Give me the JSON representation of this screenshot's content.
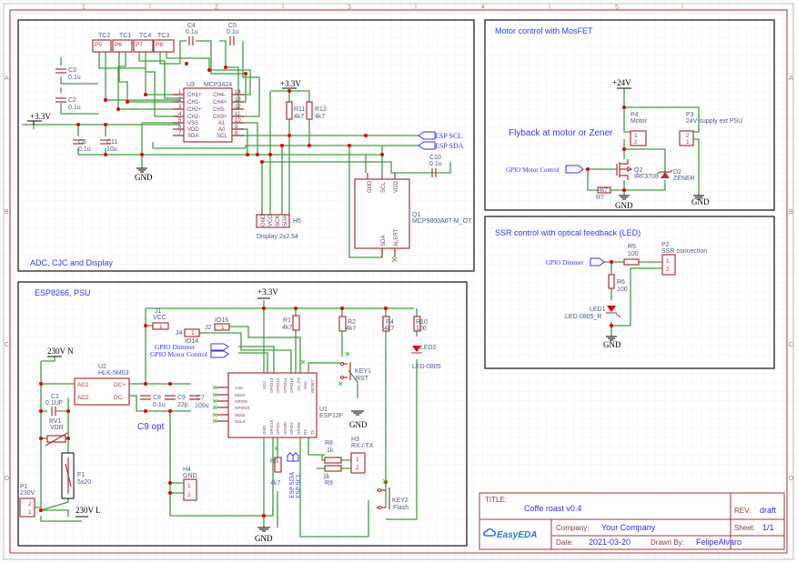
{
  "sheet": {
    "columns": [
      "1",
      "2",
      "3",
      "4",
      "5"
    ],
    "rows": [
      "A",
      "B",
      "C",
      "D"
    ]
  },
  "adc": {
    "title": "ADC, CJC and Display",
    "connectors": [
      {
        "ref": "P5",
        "name": "TC2"
      },
      {
        "ref": "P6",
        "name": "TC1"
      },
      {
        "ref": "P7",
        "name": "TC4"
      },
      {
        "ref": "P8",
        "name": "TC3"
      }
    ],
    "c4": {
      "ref": "C4",
      "value": "0.1u"
    },
    "c5": {
      "ref": "C5",
      "value": "0.1u"
    },
    "c3": {
      "ref": "C3",
      "value": "0.1u"
    },
    "c2": {
      "ref": "C2",
      "value": "0.1u"
    },
    "c6": {
      "ref": "C6",
      "value": "0.1u"
    },
    "c11": {
      "ref": "C11",
      "value": "10u"
    },
    "c10": {
      "ref": "C10",
      "value": "0.1u"
    },
    "u3": {
      "ref": "U3",
      "part": "MCP3424",
      "left_pins": [
        "CH1+",
        "CH1-",
        "CH2+",
        "CH2-",
        "VSS",
        "VDD",
        "SDA"
      ],
      "right_pins": [
        "CH4-",
        "CH4+",
        "CH3-",
        "CH3+",
        "A1",
        "A0",
        "SCL"
      ],
      "left_nums": [
        "1",
        "2",
        "3",
        "4",
        "5",
        "6",
        "7"
      ],
      "right_nums": [
        "14",
        "13",
        "12",
        "11",
        "10",
        "9",
        "8"
      ]
    },
    "r11": {
      "ref": "R11",
      "value": "4k7"
    },
    "r12": {
      "ref": "R12",
      "value": "4k7"
    },
    "pwr_3v3": "+3.3V",
    "pwr_3v3_b": "+3.3V",
    "gnd": "GND",
    "net_scl": "ESP SCL",
    "net_sda": "ESP SDA",
    "q1": {
      "ref": "Q1",
      "part": "MCP9800A0T-M_OT",
      "pins": [
        "GND",
        "SCL",
        "VDD",
        "SDA",
        "ALERT"
      ]
    },
    "h5": {
      "ref": "H5",
      "desc": "Display 2x2.54",
      "pins": [
        "GND",
        "VCC",
        "SCK",
        "SDA"
      ]
    }
  },
  "motor": {
    "title": "Motor control with MosFET",
    "note": "Flyback at motor or Zener",
    "pwr_24v": "+24V",
    "p4": {
      "ref": "P4",
      "name": "Motor",
      "pins": [
        "1",
        "2"
      ]
    },
    "p3": {
      "ref": "P3",
      "name": "24V supply ext PSU",
      "pins": [
        "2",
        "1"
      ]
    },
    "net_gpio": "GPIO Motor Control",
    "q2": {
      "ref": "Q2",
      "part": "IRF3708"
    },
    "d2": {
      "ref": "D2",
      "part": "ZENER"
    },
    "r7": {
      "ref": "R7",
      "value": "4k7"
    },
    "gnd1": "GND",
    "gnd2": "GND"
  },
  "ssr": {
    "title": "SSR control with optical feedback (LED)",
    "r5": {
      "ref": "R5",
      "value": "100"
    },
    "p2": {
      "ref": "P2",
      "name": "SSR connection",
      "pins": [
        "1",
        "2"
      ]
    },
    "net_gpio": "GPIO Dimmer",
    "r6": {
      "ref": "R6",
      "value": "100"
    },
    "led1": {
      "ref": "LED1",
      "part": "LED-0805_R"
    },
    "gnd": "GND"
  },
  "esp": {
    "title": "ESP8266, PSU",
    "j1": {
      "ref": "J1",
      "name": "VCC",
      "pin": "1"
    },
    "j4": {
      "ref": "J4",
      "name": "IO14",
      "pin": "1"
    },
    "j2": {
      "ref": "J2",
      "name": "IO16",
      "pin": "1"
    },
    "net_dimmer": "GPIO Dimmer",
    "net_motor": "GPIO Motor Control",
    "pwr_n": "230V N",
    "pwr_l": "230V L",
    "pwr_3v3": "+3.3V",
    "gnd1": "GND",
    "gnd2": "GND",
    "u2": {
      "ref": "U2",
      "part": "HLK-5M03",
      "pins": [
        "AC1",
        "AC2",
        "DC+",
        "DC-"
      ]
    },
    "c1": {
      "ref": "C1",
      "value": "0.1UF"
    },
    "rv1": {
      "ref": "RV1",
      "value": "VDR"
    },
    "f1": {
      "ref": "F1",
      "value": "5x20"
    },
    "p1": {
      "ref": "P1",
      "name": "230V",
      "pins": [
        "2",
        "1"
      ]
    },
    "c8": {
      "ref": "C8",
      "value": "0.1u"
    },
    "c9": {
      "ref": "C9",
      "value": "22p"
    },
    "c7": {
      "ref": "C7",
      "value": "100u"
    },
    "c9_note": "C9 opt",
    "h4": {
      "ref": "H4",
      "name": "GND",
      "pins": [
        "1",
        "2"
      ]
    },
    "r1": {
      "ref": "R1",
      "value": "4k7"
    },
    "r2": {
      "ref": "R2",
      "value": "4k7"
    },
    "r4": {
      "ref": "R4",
      "value": "4k7"
    },
    "r10": {
      "ref": "R10",
      "value": "100"
    },
    "led2": {
      "ref": "LED2",
      "part": "LED-0805"
    },
    "key1": {
      "ref": "KEY1",
      "name": "RST"
    },
    "key2": {
      "ref": "KEY2",
      "name": "Flash"
    },
    "u1": {
      "ref": "U1",
      "part": "ESP12F",
      "left_pins": [
        "CS0",
        "MISO",
        "GPIO9",
        "GPIO10",
        "MOSI",
        "SCLK"
      ],
      "top_pins": [
        "VCC",
        "GPIO13",
        "GPIO12",
        "GPIO14",
        "GPIO16",
        "CH_PD",
        "ADC",
        "RESET"
      ],
      "bottom_pins": [
        "GND",
        "GPIO15",
        "GPIO2",
        "GPIO0",
        "GPIO4",
        "GPIO5",
        "RX",
        "TX"
      ]
    },
    "r8": {
      "ref": "R8",
      "value": "1k"
    },
    "r9": {
      "ref": "R9",
      "value": "1k"
    },
    "r3": {
      "ref": "R3",
      "value": "4k7"
    },
    "h3": {
      "ref": "H3",
      "name": "RX / TX",
      "pins": [
        "1",
        "2"
      ]
    },
    "net_sda": "ESP SDA",
    "net_scl": "ESP SCL"
  },
  "title_block": {
    "title_label": "TITLE:",
    "title": "Coffe roast v0.4",
    "rev_label": "REV:",
    "rev": "draft",
    "logo": "EasyEDA",
    "company_label": "Company:",
    "company": "Your Company",
    "sheet_label": "Sheet:",
    "sheet": "1/1",
    "date_label": "Date:",
    "date": "2021-03-20",
    "drawn_label": "Drawn By:",
    "drawn_by": "FelipeAlvaro"
  },
  "colors": {
    "wire": "#3c9e3c",
    "component": "#a83232",
    "net_label": "#3333ee",
    "section_title": "#2a3cf0",
    "junction": "#dd0000"
  }
}
